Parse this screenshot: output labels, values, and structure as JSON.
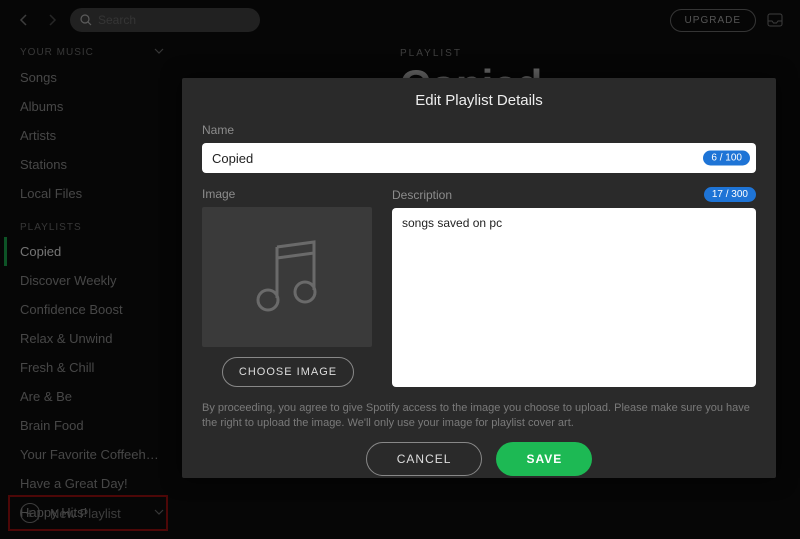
{
  "topbar": {
    "search_placeholder": "Search",
    "upgrade_label": "UPGRADE"
  },
  "sidebar": {
    "your_music_heading": "YOUR MUSIC",
    "your_music": [
      "Songs",
      "Albums",
      "Artists",
      "Stations",
      "Local Files"
    ],
    "playlists_heading": "PLAYLISTS",
    "playlists": [
      "Copied",
      "Discover Weekly",
      "Confidence Boost",
      "Relax & Unwind",
      "Fresh & Chill",
      "Are & Be",
      "Brain Food",
      "Your Favorite Coffeeh…",
      "Have a Great Day!",
      "Happy Hits!"
    ],
    "new_playlist_label": "New Playlist"
  },
  "main": {
    "overline": "PLAYLIST",
    "title": "Copied"
  },
  "modal": {
    "title": "Edit Playlist Details",
    "name_label": "Name",
    "name_value": "Copied",
    "name_counter": "6 / 100",
    "image_label": "Image",
    "choose_image_label": "CHOOSE IMAGE",
    "description_label": "Description",
    "description_counter": "17 / 300",
    "description_value": "songs saved on pc",
    "disclaimer": "By proceeding, you agree to give Spotify access to the image you choose to upload. Please make sure you have the right to upload the image. We'll only use your image for playlist cover art.",
    "cancel_label": "CANCEL",
    "save_label": "SAVE"
  },
  "colors": {
    "accent_green": "#1db954",
    "badge_blue": "#1e74d6",
    "highlight_red_border": "#a11111"
  }
}
